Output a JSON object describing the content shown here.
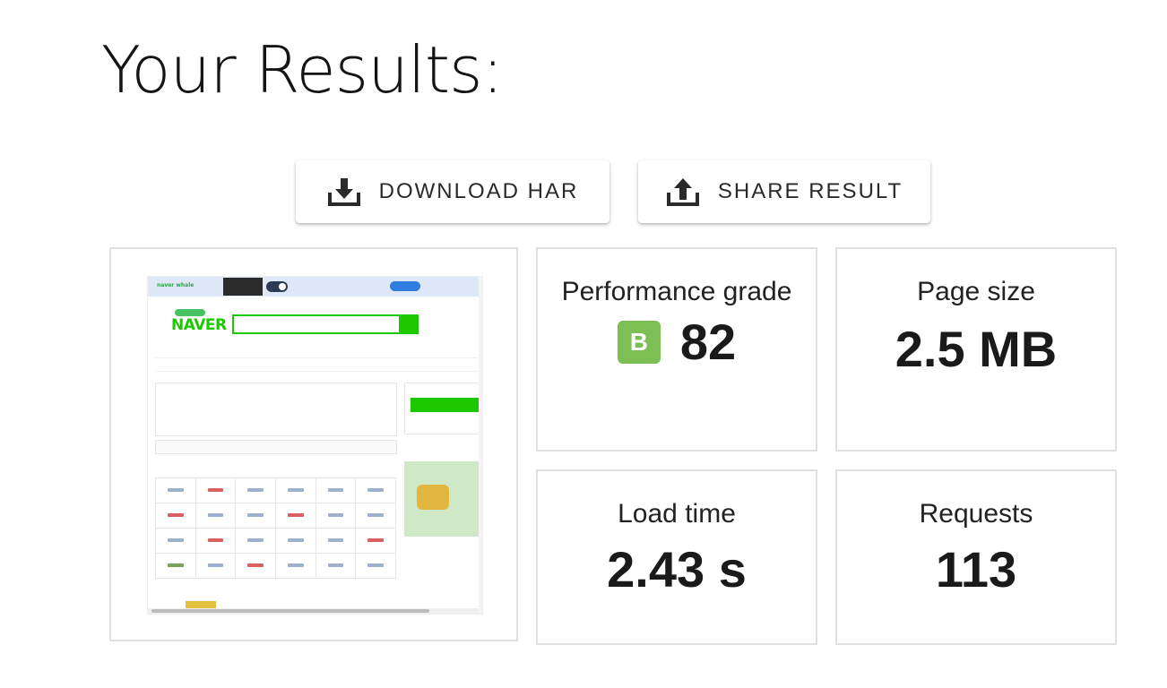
{
  "page": {
    "title": "Your Results:"
  },
  "actions": {
    "download_label": "DOWNLOAD HAR",
    "share_label": "SHARE RESULT",
    "download_icon": "download-icon",
    "share_icon": "share-icon"
  },
  "screenshot": {
    "site_logo": "NAVER",
    "banner_text": "naver whale"
  },
  "metrics": {
    "performance": {
      "label": "Performance grade",
      "grade": "B",
      "score": "82",
      "grade_color": "#7bbf55"
    },
    "page_size": {
      "label": "Page size",
      "value": "2.5 MB"
    },
    "load_time": {
      "label": "Load time",
      "value": "2.43 s"
    },
    "requests": {
      "label": "Requests",
      "value": "113"
    }
  }
}
